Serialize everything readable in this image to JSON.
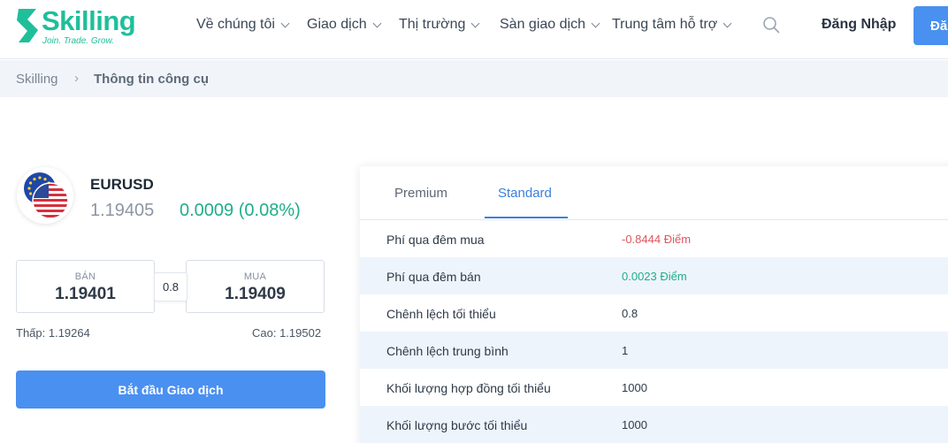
{
  "header": {
    "logo_text": "Skilling",
    "logo_tagline": "Join. Trade. Grow.",
    "nav": [
      {
        "label": "Về chúng tôi"
      },
      {
        "label": "Giao dịch"
      },
      {
        "label": "Thị trường"
      },
      {
        "label": "Sàn giao dịch"
      },
      {
        "label": "Trung tâm hỗ trợ"
      }
    ],
    "search_icon": "search-icon",
    "login_label": "Đăng Nhập",
    "register_label": "Đă"
  },
  "breadcrumb": {
    "home": "Skilling",
    "separator": "›",
    "current": "Thông tin công cụ"
  },
  "instrument": {
    "symbol": "EURUSD",
    "price": "1.19405",
    "change": "0.0009 (0.08%)",
    "sell_label": "BÁN",
    "sell_value": "1.19401",
    "spread": "0.8",
    "buy_label": "MUA",
    "buy_value": "1.19409",
    "low": "Thấp: 1.19264",
    "high": "Cao: 1.19502",
    "start_button": "Bắt đầu Giao dịch"
  },
  "table": {
    "tabs": [
      {
        "label": "Premium"
      },
      {
        "label": "Standard"
      }
    ],
    "active_tab": "Standard",
    "rows": [
      {
        "label": "Phí qua đêm mua",
        "value": "-0.8444 Điểm",
        "color": "#e0555a"
      },
      {
        "label": "Phí qua đêm bán",
        "value": "0.0023 Điểm",
        "color": "#1fae8a"
      },
      {
        "label": "Chênh lệch tối thiểu",
        "value": "0.8",
        "color": "#2e3a48"
      },
      {
        "label": "Chênh lệch trung bình",
        "value": "1",
        "color": "#2e3a48"
      },
      {
        "label": "Khối lượng hợp đồng tối thiểu",
        "value": "1000",
        "color": "#2e3a48"
      },
      {
        "label": "Khối lượng bước tối thiểu",
        "value": "1000",
        "color": "#2e3a48"
      }
    ]
  },
  "colors": {
    "brand": "#1fbf9a",
    "accent": "#4a90f0",
    "positive": "#1fae8a",
    "negative": "#e0555a"
  }
}
